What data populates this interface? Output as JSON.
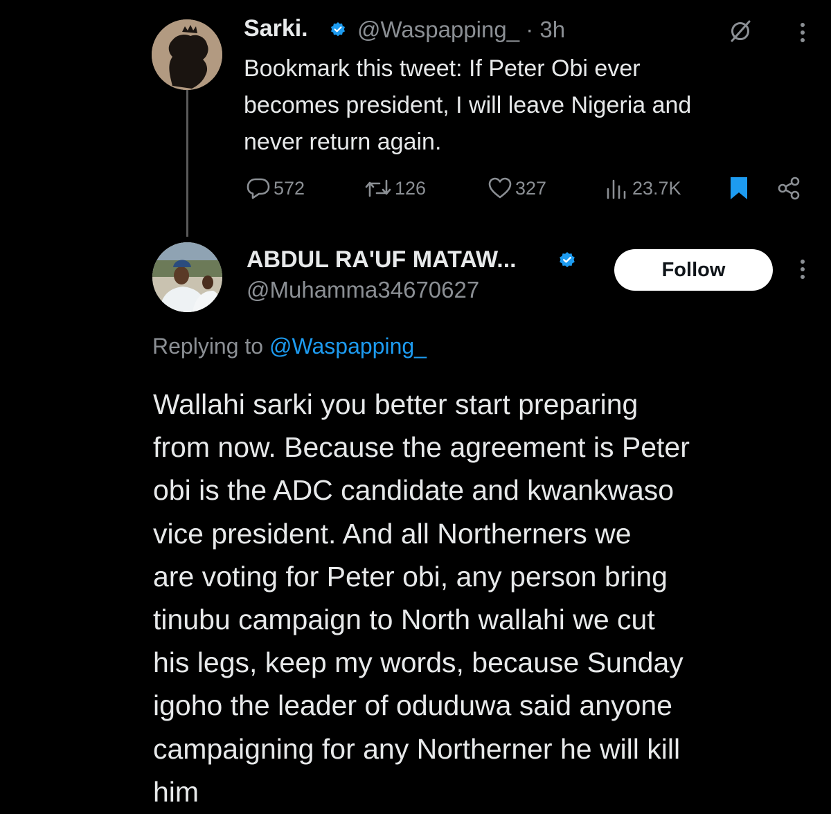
{
  "parent_tweet": {
    "display_name": "Sarki.",
    "handle": "@Waspapping_",
    "timestamp": "· 3h",
    "verified_icon": "verified-badge-icon",
    "text": "Bookmark this tweet: If Peter Obi ever\nbecomes president, I will leave Nigeria and\nnever return again.",
    "metrics": {
      "replies": "572",
      "reposts": "126",
      "likes": "327",
      "views": "23.7K"
    }
  },
  "reply_tweet": {
    "display_name": "ABDUL RA'UF MATAW...",
    "handle": "@Muhamma34670627",
    "follow_label": "Follow",
    "replying_prefix": "Replying to",
    "replying_handle": "@Waspapping_",
    "text": "Wallahi sarki you better start preparing\nfrom now.  Because the agreement is Peter\nobi is the ADC candidate and kwankwaso\nvice president.  And all Northerners we\nare voting for Peter obi, any person bring\ntinubu campaign to North wallahi we cut\nhis legs, keep my words,  because Sunday\nigoho the leader of oduduwa said anyone\ncampaigning for any Northerner he will kill\nhim"
  },
  "colors": {
    "background": "#000000",
    "text_primary": "#e7e9ea",
    "text_secondary": "#8b8f94",
    "accent_blue": "#1d9bf0",
    "follow_bg": "#ffffff"
  }
}
